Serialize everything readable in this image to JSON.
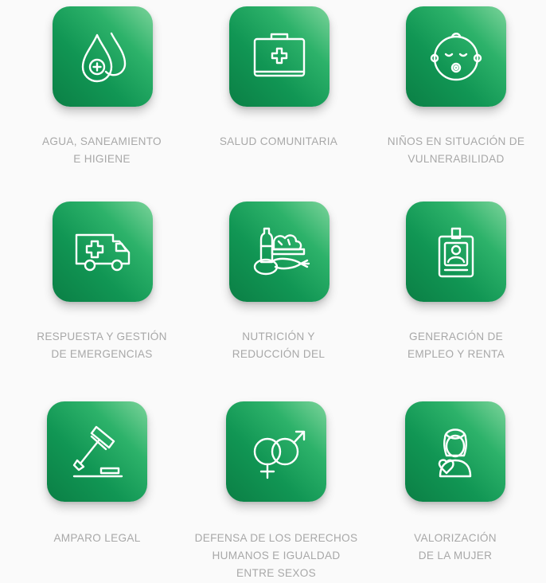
{
  "categories": [
    {
      "id": "water",
      "icon": "water-drops-icon",
      "lines": [
        "AGUA, SANEAMIENTO",
        "E HIGIENE"
      ]
    },
    {
      "id": "health",
      "icon": "first-aid-kit-icon",
      "lines": [
        "SALUD COMUNITARIA"
      ]
    },
    {
      "id": "children",
      "icon": "baby-face-icon",
      "lines": [
        "NIÑOS EN SITUACIÓN DE",
        "VULNERABILIDAD"
      ]
    },
    {
      "id": "emergency",
      "icon": "ambulance-icon",
      "lines": [
        "RESPUESTA Y GESTIÓN",
        "DE EMERGENCIAS"
      ]
    },
    {
      "id": "nutrition",
      "icon": "food-basket-icon",
      "lines": [
        "NUTRICIÓN Y",
        "REDUCCIÓN DEL"
      ]
    },
    {
      "id": "employment",
      "icon": "id-badge-icon",
      "lines": [
        "GENERACIÓN DE",
        "EMPLEO Y RENTA"
      ]
    },
    {
      "id": "legal",
      "icon": "gavel-icon",
      "lines": [
        "AMPARO LEGAL"
      ]
    },
    {
      "id": "rights",
      "icon": "gender-symbols-icon",
      "lines": [
        "DEFENSA DE LOS DERECHOS",
        "HUMANOS E IGUALDAD",
        "ENTRE SEXOS"
      ]
    },
    {
      "id": "women",
      "icon": "woman-heart-icon",
      "lines": [
        "VALORIZACIÓN",
        "DE LA MUJER"
      ]
    }
  ],
  "colors": {
    "tile_light": "#7bd39a",
    "tile_mid": "#119654",
    "tile_dark": "#0b7f45",
    "label": "#a8a8a8",
    "background": "#fafafa"
  }
}
